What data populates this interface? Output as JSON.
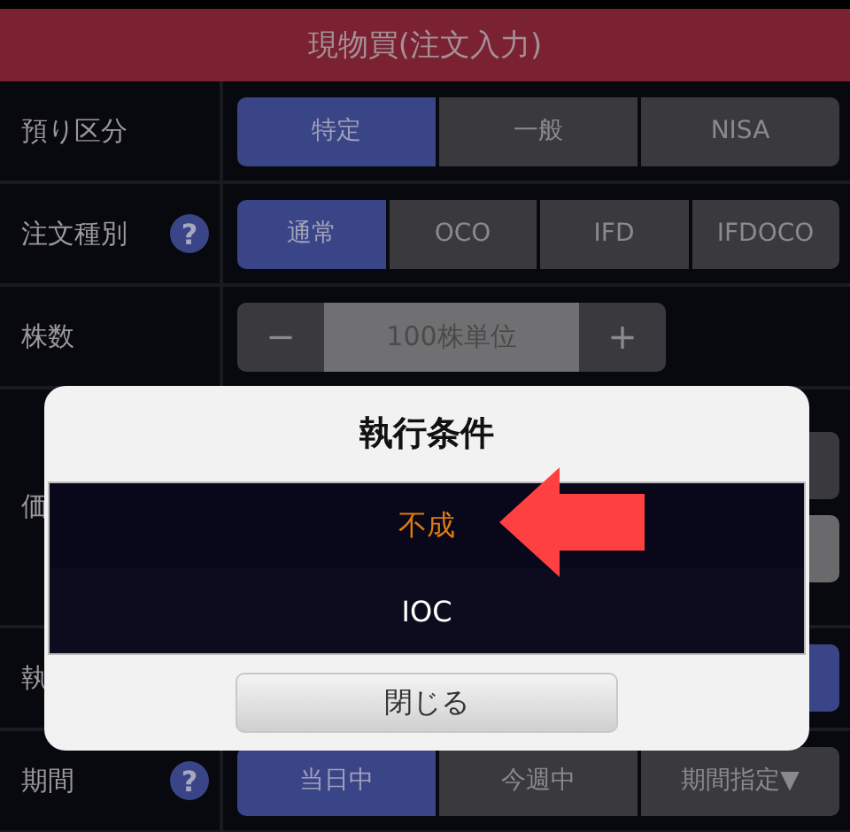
{
  "header": {
    "title": "現物買(注文入力)"
  },
  "rows": [
    {
      "label": "預り区分",
      "kind": "segments",
      "options": [
        {
          "label": "特定",
          "selected": true
        },
        {
          "label": "一般",
          "selected": false
        },
        {
          "label": "NISA",
          "selected": false
        }
      ]
    },
    {
      "label": "注文種別",
      "help": "?",
      "kind": "segments",
      "options": [
        {
          "label": "通常",
          "selected": true
        },
        {
          "label": "OCO",
          "selected": false
        },
        {
          "label": "IFD",
          "selected": false
        },
        {
          "label": "IFDOCO",
          "selected": false
        }
      ]
    },
    {
      "label": "株数",
      "kind": "stepper",
      "minus": "−",
      "placeholder": "100株単位",
      "plus": "+"
    },
    {
      "label": "価",
      "kind": "price"
    },
    {
      "label": "執",
      "kind": "condition"
    },
    {
      "label": "期間",
      "help": "?",
      "kind": "segments",
      "options": [
        {
          "label": "当日中",
          "selected": true
        },
        {
          "label": "今週中",
          "selected": false
        },
        {
          "label": "期間指定▼",
          "selected": false
        }
      ]
    }
  ],
  "dialog": {
    "title": "執行条件",
    "options": [
      {
        "label": "不成",
        "selected": true
      },
      {
        "label": "IOC",
        "selected": false
      }
    ],
    "close": "閉じる"
  }
}
